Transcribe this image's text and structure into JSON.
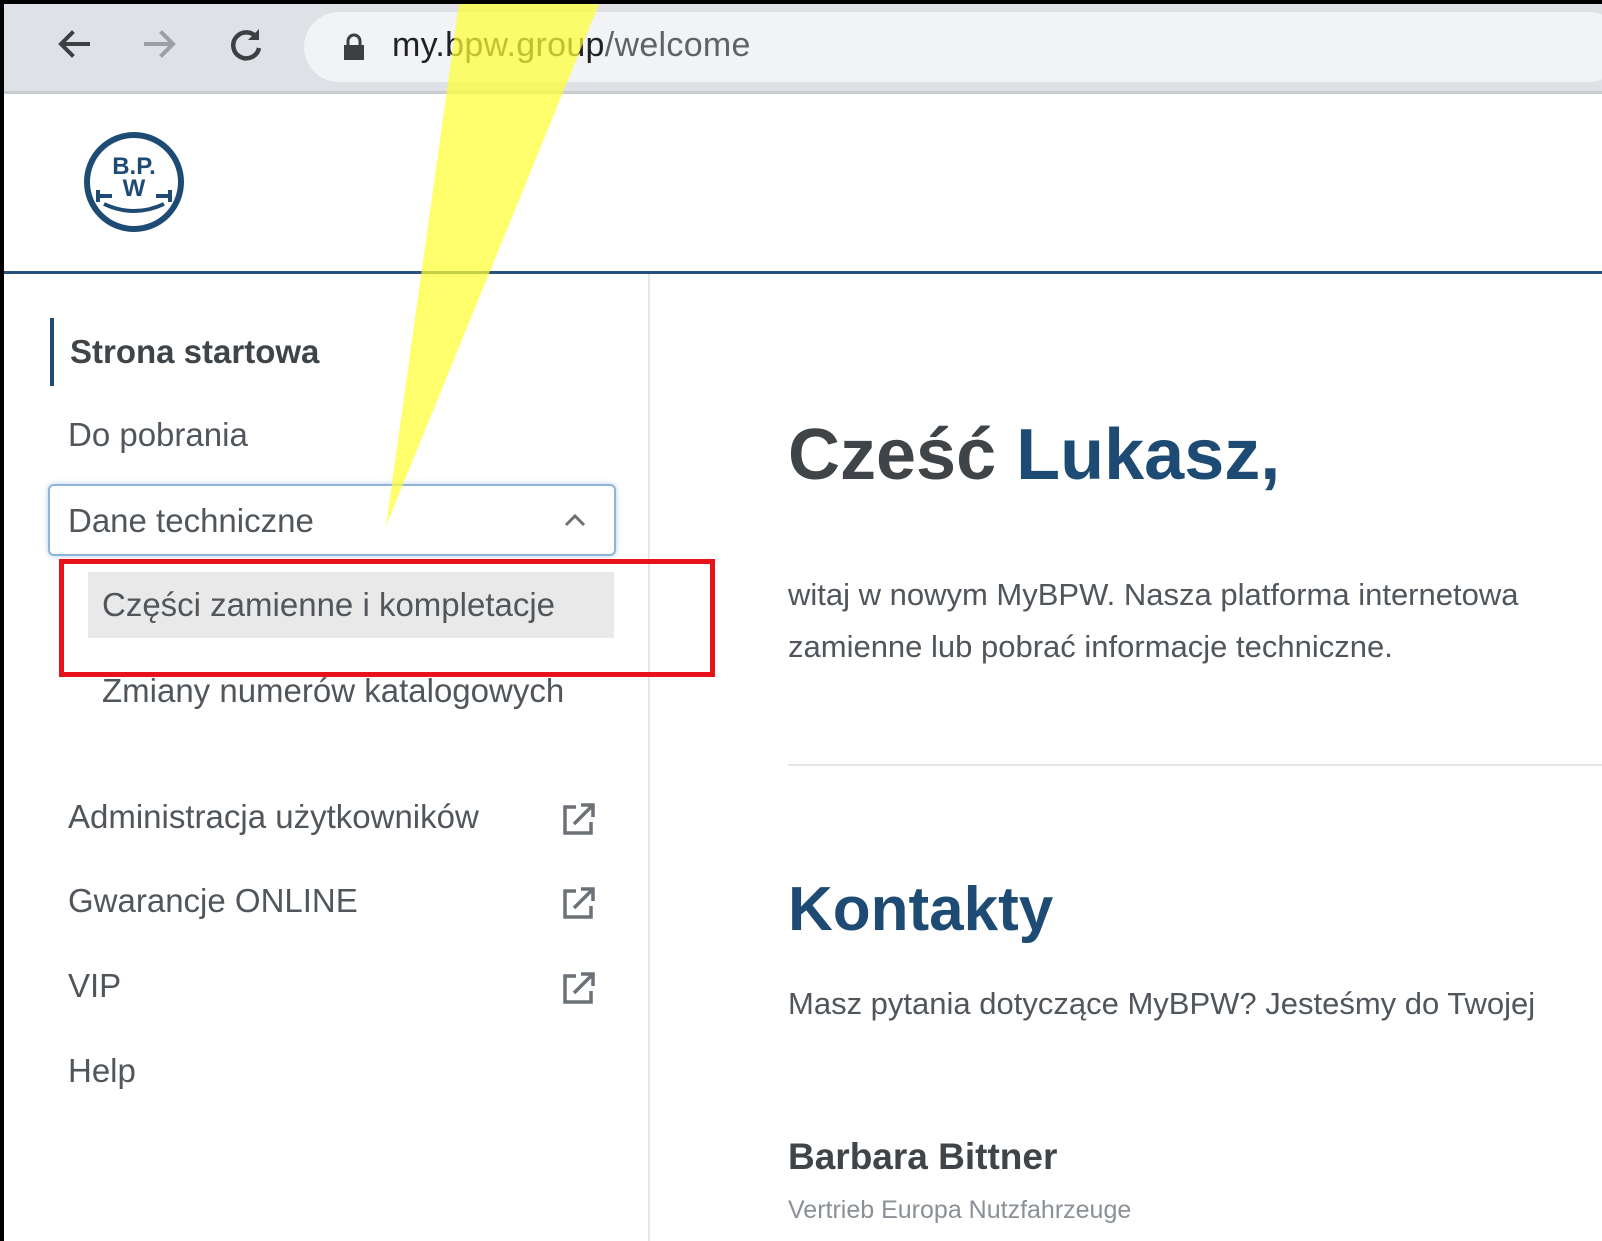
{
  "browser": {
    "url_host": "my.bpw.group",
    "url_path": "/welcome",
    "icons": [
      "back-arrow-icon",
      "forward-arrow-icon",
      "reload-icon",
      "lock-icon"
    ]
  },
  "header": {
    "logo_text": "BPW"
  },
  "sidebar": {
    "active_item": "Strona startowa",
    "items": [
      {
        "label": "Do pobrania"
      },
      {
        "label": "Dane techniczne",
        "expanded": true
      },
      {
        "label": "Administracja użytkowników",
        "external": true
      },
      {
        "label": "Gwarancje ONLINE",
        "external": true
      },
      {
        "label": "VIP",
        "external": true
      },
      {
        "label": "Help"
      }
    ],
    "sub_items": [
      {
        "label": "Części zamienne i kompletacje",
        "selected": true
      },
      {
        "label": "Zmiany numerów katalogowych"
      }
    ]
  },
  "main": {
    "greeting_prefix": "Cześć ",
    "greeting_name": "Lukasz,",
    "intro_line1": "witaj w nowym MyBPW. Nasza platforma internetowa",
    "intro_line2": "zamienne lub pobrać informacje techniczne.",
    "contacts_title": "Kontakty",
    "contacts_intro": "Masz pytania dotyczące MyBPW? Jesteśmy do Twojej",
    "contact_name": "Barbara Bittner",
    "contact_role": "Vertrieb Europa Nutzfahrzeuge"
  },
  "colors": {
    "brand_blue": "#1d4b73",
    "highlight_red": "#e8131a",
    "callout_yellow": "#ffff33"
  }
}
